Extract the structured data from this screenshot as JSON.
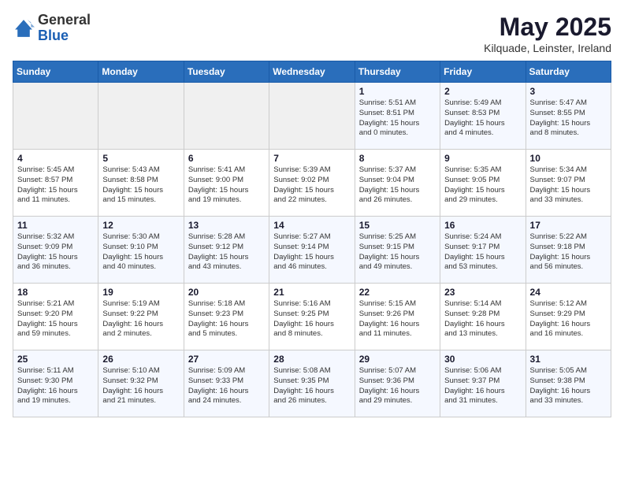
{
  "logo": {
    "general": "General",
    "blue": "Blue"
  },
  "header": {
    "title": "May 2025",
    "subtitle": "Kilquade, Leinster, Ireland"
  },
  "days_of_week": [
    "Sunday",
    "Monday",
    "Tuesday",
    "Wednesday",
    "Thursday",
    "Friday",
    "Saturday"
  ],
  "weeks": [
    [
      {
        "day": "",
        "info": ""
      },
      {
        "day": "",
        "info": ""
      },
      {
        "day": "",
        "info": ""
      },
      {
        "day": "",
        "info": ""
      },
      {
        "day": "1",
        "info": "Sunrise: 5:51 AM\nSunset: 8:51 PM\nDaylight: 15 hours\nand 0 minutes."
      },
      {
        "day": "2",
        "info": "Sunrise: 5:49 AM\nSunset: 8:53 PM\nDaylight: 15 hours\nand 4 minutes."
      },
      {
        "day": "3",
        "info": "Sunrise: 5:47 AM\nSunset: 8:55 PM\nDaylight: 15 hours\nand 8 minutes."
      }
    ],
    [
      {
        "day": "4",
        "info": "Sunrise: 5:45 AM\nSunset: 8:57 PM\nDaylight: 15 hours\nand 11 minutes."
      },
      {
        "day": "5",
        "info": "Sunrise: 5:43 AM\nSunset: 8:58 PM\nDaylight: 15 hours\nand 15 minutes."
      },
      {
        "day": "6",
        "info": "Sunrise: 5:41 AM\nSunset: 9:00 PM\nDaylight: 15 hours\nand 19 minutes."
      },
      {
        "day": "7",
        "info": "Sunrise: 5:39 AM\nSunset: 9:02 PM\nDaylight: 15 hours\nand 22 minutes."
      },
      {
        "day": "8",
        "info": "Sunrise: 5:37 AM\nSunset: 9:04 PM\nDaylight: 15 hours\nand 26 minutes."
      },
      {
        "day": "9",
        "info": "Sunrise: 5:35 AM\nSunset: 9:05 PM\nDaylight: 15 hours\nand 29 minutes."
      },
      {
        "day": "10",
        "info": "Sunrise: 5:34 AM\nSunset: 9:07 PM\nDaylight: 15 hours\nand 33 minutes."
      }
    ],
    [
      {
        "day": "11",
        "info": "Sunrise: 5:32 AM\nSunset: 9:09 PM\nDaylight: 15 hours\nand 36 minutes."
      },
      {
        "day": "12",
        "info": "Sunrise: 5:30 AM\nSunset: 9:10 PM\nDaylight: 15 hours\nand 40 minutes."
      },
      {
        "day": "13",
        "info": "Sunrise: 5:28 AM\nSunset: 9:12 PM\nDaylight: 15 hours\nand 43 minutes."
      },
      {
        "day": "14",
        "info": "Sunrise: 5:27 AM\nSunset: 9:14 PM\nDaylight: 15 hours\nand 46 minutes."
      },
      {
        "day": "15",
        "info": "Sunrise: 5:25 AM\nSunset: 9:15 PM\nDaylight: 15 hours\nand 49 minutes."
      },
      {
        "day": "16",
        "info": "Sunrise: 5:24 AM\nSunset: 9:17 PM\nDaylight: 15 hours\nand 53 minutes."
      },
      {
        "day": "17",
        "info": "Sunrise: 5:22 AM\nSunset: 9:18 PM\nDaylight: 15 hours\nand 56 minutes."
      }
    ],
    [
      {
        "day": "18",
        "info": "Sunrise: 5:21 AM\nSunset: 9:20 PM\nDaylight: 15 hours\nand 59 minutes."
      },
      {
        "day": "19",
        "info": "Sunrise: 5:19 AM\nSunset: 9:22 PM\nDaylight: 16 hours\nand 2 minutes."
      },
      {
        "day": "20",
        "info": "Sunrise: 5:18 AM\nSunset: 9:23 PM\nDaylight: 16 hours\nand 5 minutes."
      },
      {
        "day": "21",
        "info": "Sunrise: 5:16 AM\nSunset: 9:25 PM\nDaylight: 16 hours\nand 8 minutes."
      },
      {
        "day": "22",
        "info": "Sunrise: 5:15 AM\nSunset: 9:26 PM\nDaylight: 16 hours\nand 11 minutes."
      },
      {
        "day": "23",
        "info": "Sunrise: 5:14 AM\nSunset: 9:28 PM\nDaylight: 16 hours\nand 13 minutes."
      },
      {
        "day": "24",
        "info": "Sunrise: 5:12 AM\nSunset: 9:29 PM\nDaylight: 16 hours\nand 16 minutes."
      }
    ],
    [
      {
        "day": "25",
        "info": "Sunrise: 5:11 AM\nSunset: 9:30 PM\nDaylight: 16 hours\nand 19 minutes."
      },
      {
        "day": "26",
        "info": "Sunrise: 5:10 AM\nSunset: 9:32 PM\nDaylight: 16 hours\nand 21 minutes."
      },
      {
        "day": "27",
        "info": "Sunrise: 5:09 AM\nSunset: 9:33 PM\nDaylight: 16 hours\nand 24 minutes."
      },
      {
        "day": "28",
        "info": "Sunrise: 5:08 AM\nSunset: 9:35 PM\nDaylight: 16 hours\nand 26 minutes."
      },
      {
        "day": "29",
        "info": "Sunrise: 5:07 AM\nSunset: 9:36 PM\nDaylight: 16 hours\nand 29 minutes."
      },
      {
        "day": "30",
        "info": "Sunrise: 5:06 AM\nSunset: 9:37 PM\nDaylight: 16 hours\nand 31 minutes."
      },
      {
        "day": "31",
        "info": "Sunrise: 5:05 AM\nSunset: 9:38 PM\nDaylight: 16 hours\nand 33 minutes."
      }
    ]
  ]
}
